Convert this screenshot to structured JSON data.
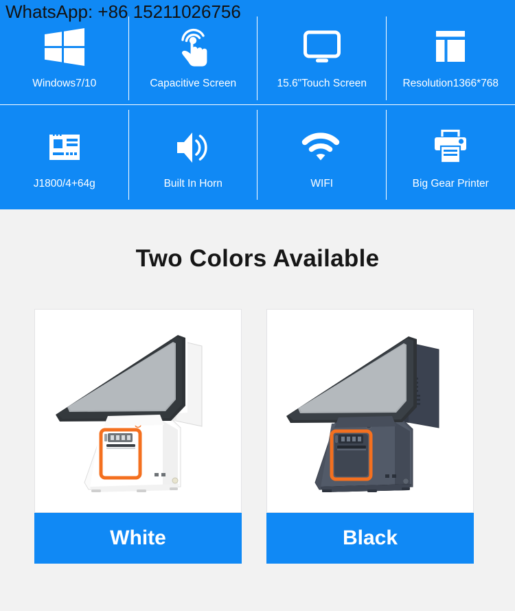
{
  "theme": {
    "brand_blue": "#1089f5",
    "page_background": "#f2f2f2",
    "card_background": "#ffffff",
    "accent_orange": "#f4701f",
    "label_text": "#ffffff"
  },
  "contact": {
    "whatsapp_text": "WhatsApp: +86 15211026756"
  },
  "features": {
    "rows": 2,
    "columns": 4,
    "items": [
      {
        "icon": "windows-logo-icon",
        "label": "Windows7/10"
      },
      {
        "icon": "touch-hand-icon",
        "label": "Capacitive Screen"
      },
      {
        "icon": "monitor-icon",
        "label": "15.6\"Touch Screen"
      },
      {
        "icon": "layout-grid-icon",
        "label": "Resolution1366*768"
      },
      {
        "icon": "motherboard-icon",
        "label": "J1800/4+64g"
      },
      {
        "icon": "speaker-icon",
        "label": "Built In Horn"
      },
      {
        "icon": "wifi-icon",
        "label": "WIFI"
      },
      {
        "icon": "printer-icon",
        "label": "Big Gear Printer"
      }
    ]
  },
  "colors_section": {
    "title": "Two Colors Available",
    "cards": [
      {
        "label": "White",
        "product_image": "pos-terminal-white"
      },
      {
        "label": "Black",
        "product_image": "pos-terminal-black"
      }
    ]
  }
}
